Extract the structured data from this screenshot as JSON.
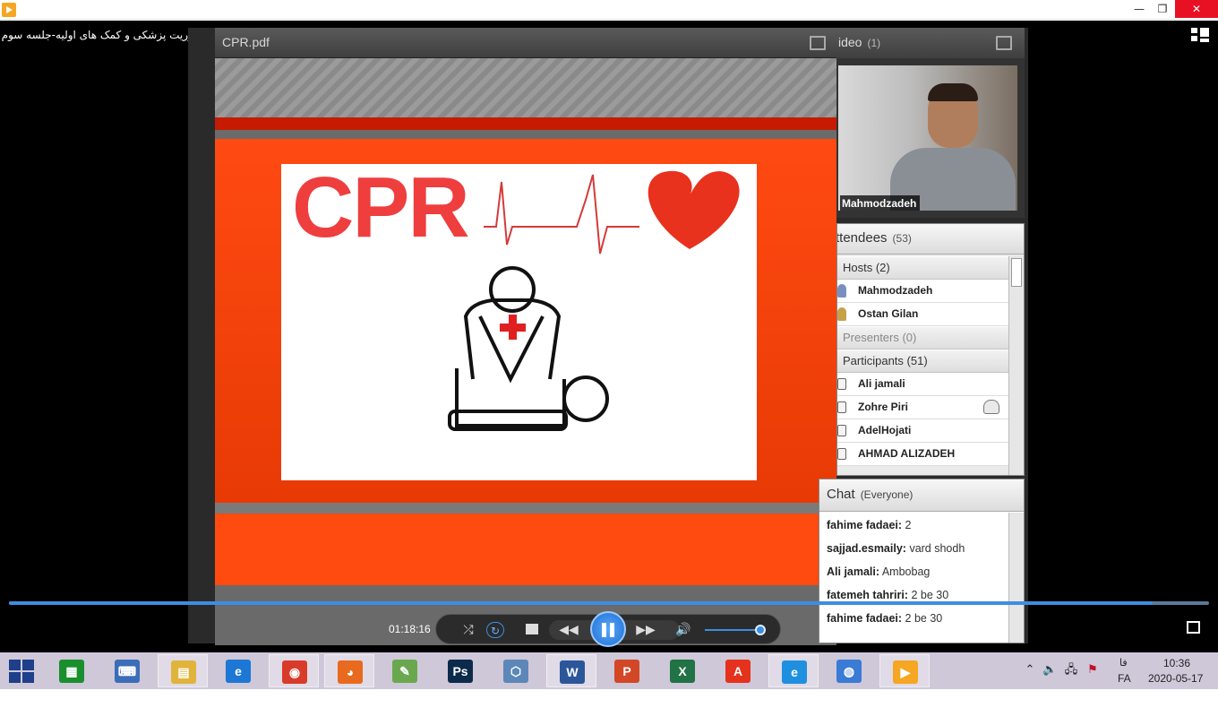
{
  "window": {
    "minimize_glyph": "—",
    "restore_glyph": "❐",
    "close_glyph": "✕"
  },
  "session": {
    "title": "فوریت پزشکی و کمک های اولیه-جلسه سوم"
  },
  "share_pod": {
    "title": "CPR.pdf",
    "slide_heading": "CPR"
  },
  "camera_pod": {
    "title": "ideo",
    "count": "(1)",
    "presenter_name": "Mahmodzadeh"
  },
  "attendees_pod": {
    "title": "ttendees",
    "count": "(53)",
    "sections": {
      "hosts": "Hosts (2)",
      "presenters": "Presenters (0)",
      "participants": "Participants (51)"
    },
    "hosts": [
      "Mahmodzadeh",
      "Ostan Gilan"
    ],
    "participants": [
      "Ali jamali",
      "Zohre Piri",
      "AdelHojati",
      "AHMAD ALIZADEH"
    ]
  },
  "chat_pod": {
    "title": "Chat",
    "scope": "(Everyone)",
    "messages": [
      {
        "sender": "fahime fadaei:",
        "text": "2"
      },
      {
        "sender": "sajjad.esmaily:",
        "text": "vard shodh"
      },
      {
        "sender": "Ali jamali:",
        "text": "Ambobag"
      },
      {
        "sender": "fatemeh tahriri:",
        "text": "2 be 30"
      },
      {
        "sender": "fahime fadaei:",
        "text": "2 be 30"
      }
    ]
  },
  "playback": {
    "time": "01:18:16",
    "progress_fraction": 0.953,
    "volume_fraction": 0.94,
    "accent_color": "#3d8ee0",
    "icons": {
      "shuffle": "⤮",
      "repeat": "↻",
      "rewind": "◀◀",
      "forward": "▶▶",
      "volume": "🔊"
    }
  },
  "taskbar": {
    "apps": [
      {
        "name": "calculator",
        "glyph": "▦",
        "color": "#1a8f2e"
      },
      {
        "name": "remote-desktop",
        "glyph": "⌨",
        "color": "#3b6db8"
      },
      {
        "name": "file-explorer",
        "glyph": "▤",
        "color": "#e0b43c"
      },
      {
        "name": "internet-explorer",
        "glyph": "e",
        "color": "#1c78d4"
      },
      {
        "name": "chrome",
        "glyph": "◉",
        "color": "#d93b2b"
      },
      {
        "name": "firefox",
        "glyph": "◕",
        "color": "#e86a1f"
      },
      {
        "name": "notepad-plus",
        "glyph": "✎",
        "color": "#6aa84f"
      },
      {
        "name": "photoshop",
        "glyph": "Ps",
        "color": "#0c2a4a"
      },
      {
        "name": "virtualbox",
        "glyph": "⬡",
        "color": "#5c87b8"
      },
      {
        "name": "word",
        "glyph": "W",
        "color": "#2b579a"
      },
      {
        "name": "powerpoint",
        "glyph": "P",
        "color": "#d24726"
      },
      {
        "name": "excel",
        "glyph": "X",
        "color": "#217346"
      },
      {
        "name": "acrobat",
        "glyph": "A",
        "color": "#e5321c"
      },
      {
        "name": "edge",
        "glyph": "e",
        "color": "#1f8fe0"
      },
      {
        "name": "internet-options",
        "glyph": "◍",
        "color": "#3a7bd5"
      },
      {
        "name": "media-player",
        "glyph": "▶",
        "color": "#f5a623"
      }
    ],
    "tray": {
      "chevron": "⌃",
      "volume": "🔈",
      "network": "🖧",
      "flag": "⚑"
    },
    "language_top": "فا",
    "language_bottom": "FA",
    "time": "10:36",
    "date": "2020-05-17"
  }
}
